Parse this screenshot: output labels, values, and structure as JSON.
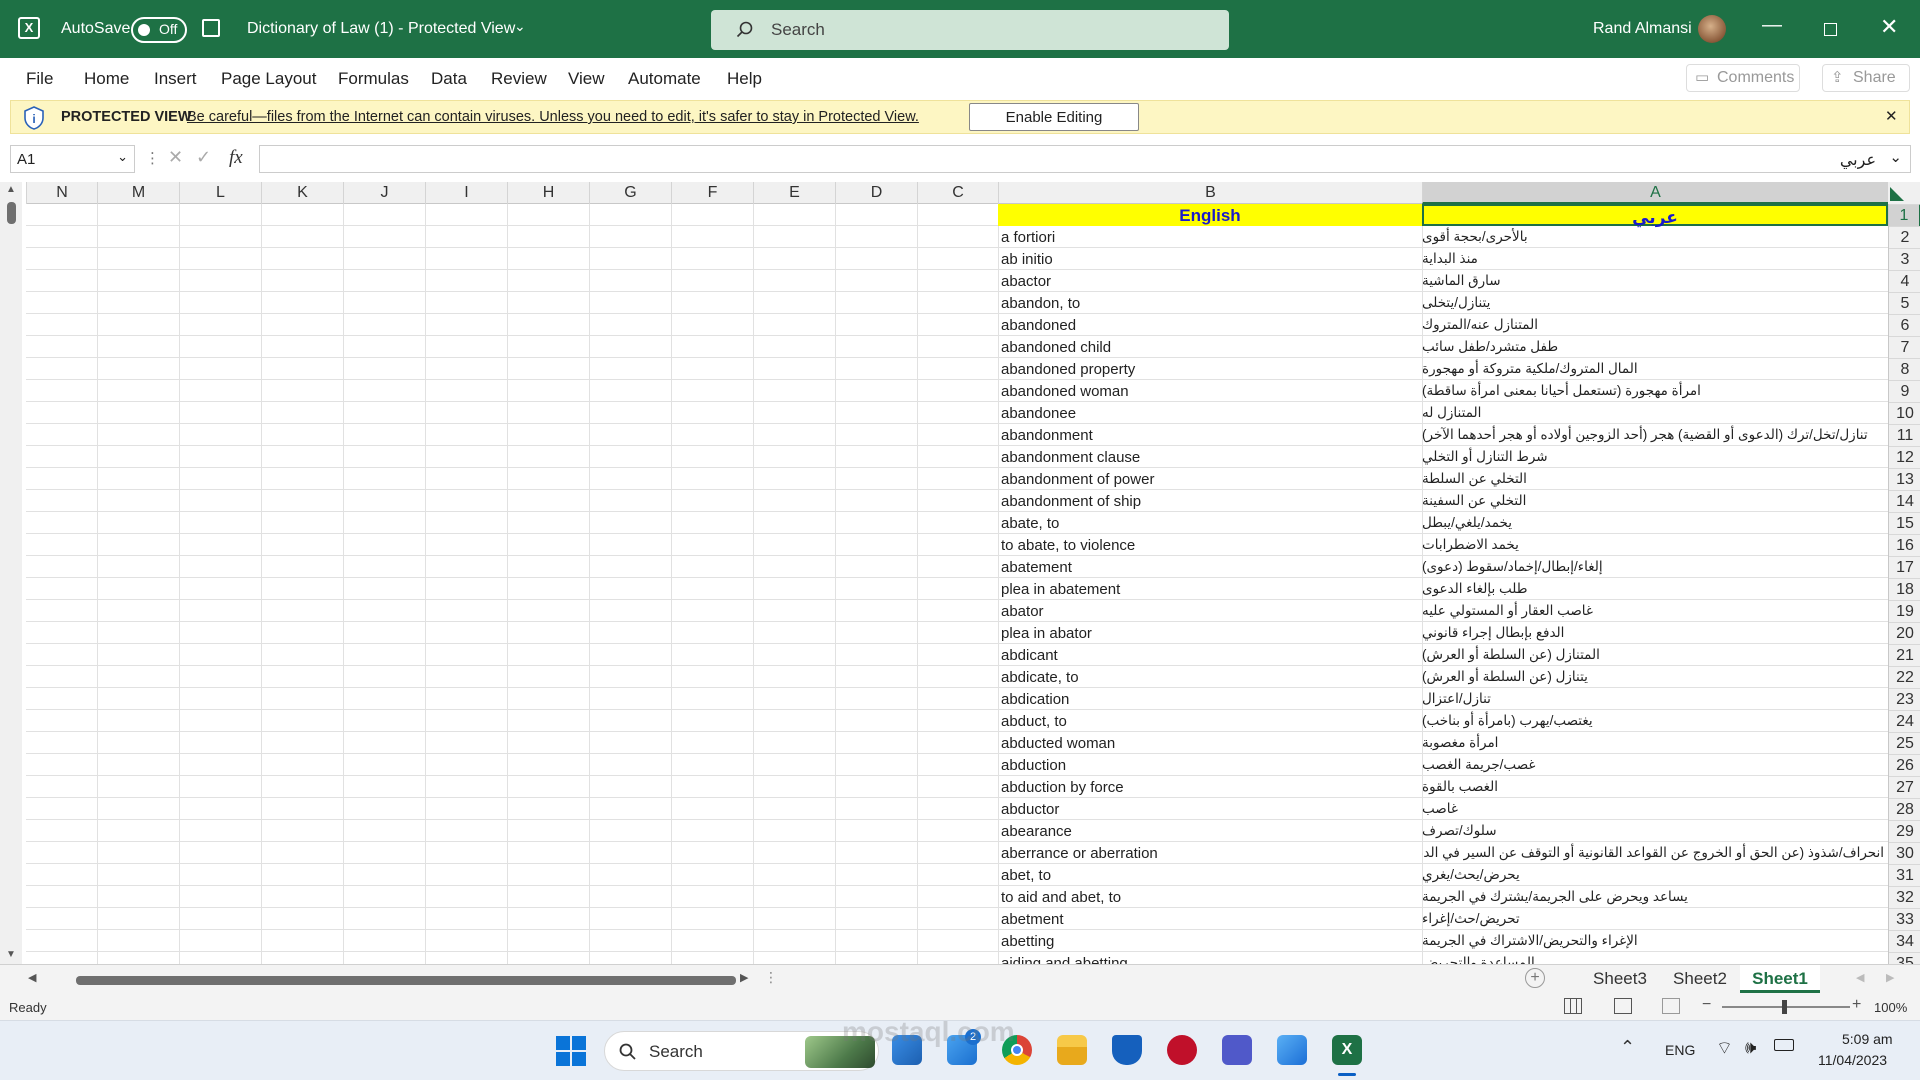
{
  "titlebar": {
    "autosave_label": "AutoSave",
    "autosave_state": "Off",
    "document_title": "Dictionary of Law (1)  -  Protected View",
    "search_placeholder": "Search",
    "user_name": "Rand Almansi"
  },
  "menu": [
    "File",
    "Home",
    "Insert",
    "Page Layout",
    "Formulas",
    "Data",
    "Review",
    "View",
    "Automate",
    "Help"
  ],
  "ribbon_right": {
    "comments": "Comments",
    "share": "Share"
  },
  "protected_bar": {
    "title": "PROTECTED VIEW",
    "message": "Be careful—files from the Internet can contain viruses. Unless you need to edit, it's safer to stay in Protected View.",
    "button": "Enable Editing"
  },
  "formula_bar": {
    "name_box": "A1",
    "fx": "fx",
    "value": "عربي"
  },
  "columns": [
    "N",
    "M",
    "L",
    "K",
    "J",
    "I",
    "H",
    "G",
    "F",
    "E",
    "D",
    "C",
    "B",
    "A"
  ],
  "header_row": {
    "english": "English",
    "arabic": "عربي"
  },
  "rows": [
    {
      "n": "2",
      "en": "a fortiori",
      "ar": "بالأحرى/بحجة أقوى"
    },
    {
      "n": "3",
      "en": "ab initio",
      "ar": "منذ البداية"
    },
    {
      "n": "4",
      "en": "abactor",
      "ar": "سارق الماشية"
    },
    {
      "n": "5",
      "en": "abandon, to",
      "ar": "يتنازل/يتخلى"
    },
    {
      "n": "6",
      "en": "abandoned",
      "ar": "المتنازل عنه/المتروك"
    },
    {
      "n": "7",
      "en": "abandoned child",
      "ar": "طفل متشرد/طفل سائب"
    },
    {
      "n": "8",
      "en": "abandoned property",
      "ar": "المال المتروك/ملكية متروكة أو مهجورة"
    },
    {
      "n": "9",
      "en": "abandoned woman",
      "ar": "امرأة مهجورة (تستعمل أحيانا بمعنى امرأة ساقطة)"
    },
    {
      "n": "10",
      "en": "abandonee",
      "ar": "المتنازل له"
    },
    {
      "n": "11",
      "en": "abandonment",
      "ar": "تنازل/تخل/ترك (الدعوى أو القضية) هجر (أحد الزوجين أولاده أو هجر أحدهما الآخر)"
    },
    {
      "n": "12",
      "en": "abandonment clause",
      "ar": "شرط التنازل أو التخلي"
    },
    {
      "n": "13",
      "en": "abandonment of power",
      "ar": "التخلي عن السلطة"
    },
    {
      "n": "14",
      "en": "abandonment of ship",
      "ar": "التخلي عن السفينة"
    },
    {
      "n": "15",
      "en": "abate, to",
      "ar": "يخمد/يلغي/يبطل"
    },
    {
      "n": "16",
      "en": "to abate, to violence",
      "ar": "يخمد الاضطرابات"
    },
    {
      "n": "17",
      "en": "abatement",
      "ar": "إلغاء/إبطال/إخماد/سقوط (دعوى)"
    },
    {
      "n": "18",
      "en": "plea in abatement",
      "ar": "طلب بإلغاء الدعوى"
    },
    {
      "n": "19",
      "en": "abator",
      "ar": "غاصب العقار أو المستولي عليه"
    },
    {
      "n": "20",
      "en": "plea in abator",
      "ar": "الدفع بإبطال إجراء قانوني"
    },
    {
      "n": "21",
      "en": "abdicant",
      "ar": "المتنازل (عن السلطة أو العرش)"
    },
    {
      "n": "22",
      "en": "abdicate, to",
      "ar": "يتنازل (عن السلطة أو العرش)"
    },
    {
      "n": "23",
      "en": "abdication",
      "ar": "تنازل/اعتزال"
    },
    {
      "n": "24",
      "en": "abduct, to",
      "ar": "يغتصب/يهرب (بامرأة أو بناخب)"
    },
    {
      "n": "25",
      "en": "abducted woman",
      "ar": "امرأة مغصوبة"
    },
    {
      "n": "26",
      "en": "abduction",
      "ar": "غصب/جريمة الغصب"
    },
    {
      "n": "27",
      "en": "abduction by force",
      "ar": "الغصب بالقوة"
    },
    {
      "n": "28",
      "en": "abductor",
      "ar": "غاصب"
    },
    {
      "n": "29",
      "en": "abearance",
      "ar": "سلوك/تصرف"
    },
    {
      "n": "30",
      "en": "aberrance or aberration",
      "ar": "انحراف/شذوذ (عن الحق أو الخروج عن القواعد القانونية أو التوقف عن السير في الدعوى)"
    },
    {
      "n": "31",
      "en": "abet, to",
      "ar": "يحرض/يحث/يغري"
    },
    {
      "n": "32",
      "en": "to aid and abet, to",
      "ar": "يساعد ويحرض على الجريمة/يشترك في الجريمة"
    },
    {
      "n": "33",
      "en": "abetment",
      "ar": "تحريض/حث/إغراء"
    },
    {
      "n": "34",
      "en": "abetting",
      "ar": "الإغراء والتحريض/الاشتراك في الجريمة"
    },
    {
      "n": "35",
      "en": "aiding and abetting",
      "ar": "المساعدة والتحريض"
    }
  ],
  "sheets": [
    "Sheet3",
    "Sheet2",
    "Sheet1"
  ],
  "active_sheet": "Sheet1",
  "status": {
    "ready": "Ready",
    "zoom": "100%"
  },
  "taskbar": {
    "search": "Search",
    "language": "ENG",
    "time": "5:09 am",
    "date": "11/04/2023",
    "mail_badge": "2"
  },
  "watermark": "mostaql.com"
}
